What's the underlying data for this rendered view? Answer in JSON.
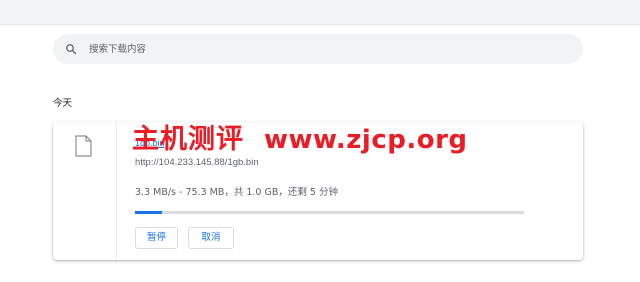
{
  "search": {
    "placeholder": "搜索下载内容",
    "icon": "search-icon"
  },
  "section": {
    "heading": "今天"
  },
  "download": {
    "file_name": "1gb.bin",
    "url": "http://104.233.145.88/1gb.bin",
    "status_text": "3.3 MB/s - 75.3 MB，共 1.0 GB，还剩 5 分钟",
    "progress": 0.07,
    "file_icon": "file-icon",
    "pause_label": "暂停",
    "cancel_label": "取消"
  },
  "watermark": {
    "cn_text": "主机测评",
    "url_text": "www.zjcp.org"
  },
  "colors": {
    "accent": "#1a73e8",
    "watermark": "#ec1c24",
    "search_bg": "#f1f3f4",
    "secondary_text": "#5f6368"
  }
}
